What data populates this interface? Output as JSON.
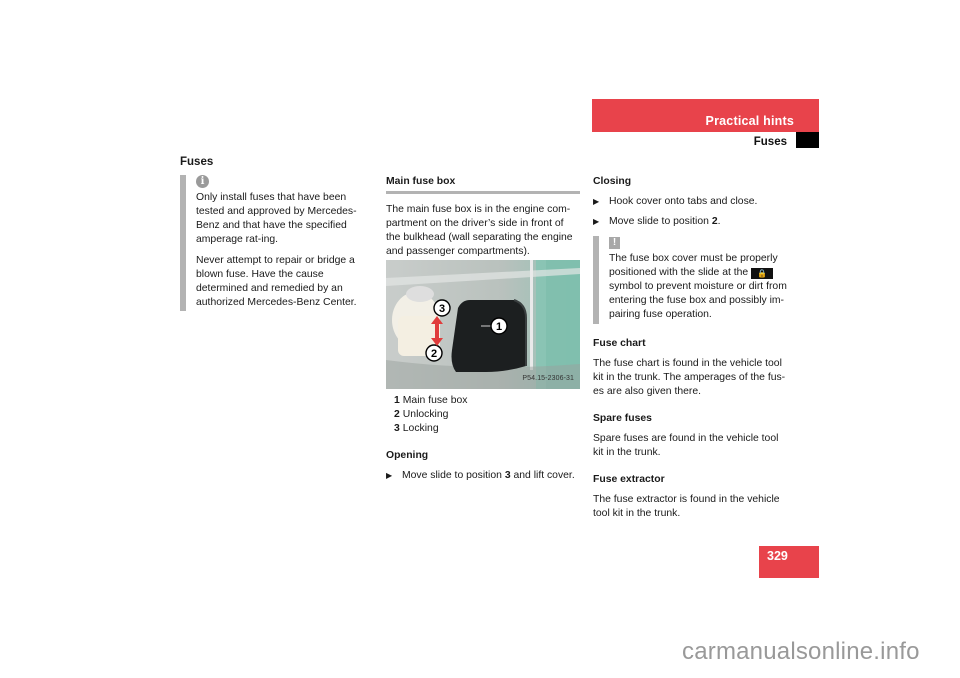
{
  "header": {
    "section": "Practical hints",
    "subsection": "Fuses",
    "accent_color": "#e8434b"
  },
  "page_title": "Fuses",
  "left_note": {
    "icon": "info-icon",
    "paragraphs": [
      "Only install fuses that have been tested and approved by Mercedes-Benz and that have the specified amperage rat-ing.",
      "Never attempt to repair or bridge a blown fuse. Have the cause determined and remedied by an authorized Mercedes-Benz Center."
    ]
  },
  "main_fuse_box": {
    "heading": "Main fuse box",
    "intro": "The main fuse box is in the engine com-partment on the driver’s side in front of the bulkhead (wall separating the engine and passenger compartments).",
    "photo": {
      "code": "P54.15-2306-31",
      "callouts": [
        "1",
        "2",
        "3"
      ]
    },
    "legend": [
      {
        "num": "1",
        "label": "Main fuse box"
      },
      {
        "num": "2",
        "label": "Unlocking"
      },
      {
        "num": "3",
        "label": "Locking"
      }
    ],
    "opening": {
      "heading": "Opening",
      "steps": [
        {
          "before": "Move slide to position ",
          "bold": "3",
          "after": " and lift cover."
        }
      ]
    }
  },
  "closing": {
    "heading": "Closing",
    "steps": [
      {
        "before": "Hook cover onto tabs and close.",
        "bold": "",
        "after": ""
      },
      {
        "before": "Move slide to position ",
        "bold": "2",
        "after": "."
      }
    ],
    "warning": {
      "icon": "warning-icon",
      "text_before": "The fuse box cover must be properly positioned with the slide at the ",
      "symbol": "lock-icon",
      "text_after": " symbol to prevent moisture or dirt from entering the fuse box and possibly im-pairing fuse operation."
    }
  },
  "fuse_chart": {
    "heading": "Fuse chart",
    "text": "The fuse chart is found in the vehicle tool kit in the trunk. The amperages of the fus-es are also given there."
  },
  "spare_fuses": {
    "heading": "Spare fuses",
    "text": "Spare fuses are found in the vehicle tool kit in the trunk."
  },
  "fuse_extractor": {
    "heading": "Fuse extractor",
    "text": "The fuse extractor is found in the vehicle tool kit in the trunk."
  },
  "page_number": "329",
  "watermark": "carmanualsonline.info"
}
